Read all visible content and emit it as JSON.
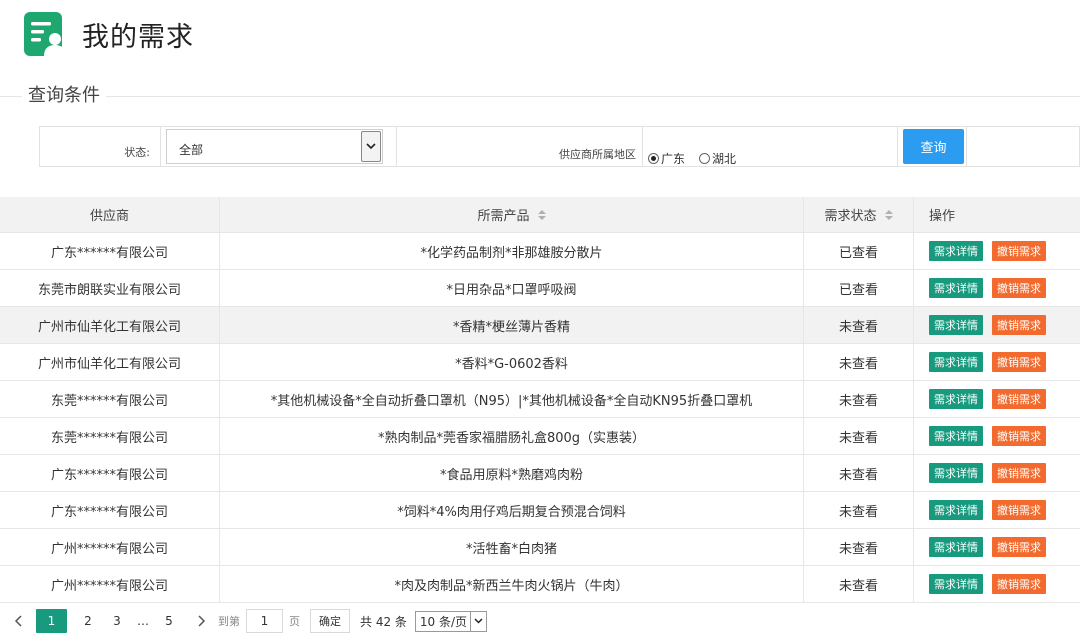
{
  "page": {
    "title": "我的需求"
  },
  "filter": {
    "section_title": "查询条件",
    "status_label": "状态:",
    "status_value": "全部",
    "region_label": "供应商所属地区",
    "region_options": [
      {
        "label": "广东",
        "checked": true
      },
      {
        "label": "湖北",
        "checked": false
      }
    ],
    "query_button": "查询"
  },
  "table": {
    "headers": [
      "供应商",
      "所需产品",
      "需求状态",
      "操作"
    ],
    "action_labels": {
      "detail": "需求详情",
      "cancel": "撤销需求"
    },
    "rows": [
      {
        "supplier": "广东******有限公司",
        "product": "*化学药品制剂*非那雄胺分散片",
        "status": "已查看"
      },
      {
        "supplier": "东莞市朗联实业有限公司",
        "product": "*日用杂品*口罩呼吸阀",
        "status": "已查看"
      },
      {
        "supplier": "广州市仙羊化工有限公司",
        "product": "*香精*梗丝薄片香精",
        "status": "未查看"
      },
      {
        "supplier": "广州市仙羊化工有限公司",
        "product": "*香料*G-0602香料",
        "status": "未查看"
      },
      {
        "supplier": "东莞******有限公司",
        "product": "*其他机械设备*全自动折叠口罩机（N95）|*其他机械设备*全自动KN95折叠口罩机",
        "status": "未查看"
      },
      {
        "supplier": "东莞******有限公司",
        "product": "*熟肉制品*莞香家福腊肠礼盒800g（实惠装）",
        "status": "未查看"
      },
      {
        "supplier": "广东******有限公司",
        "product": "*食品用原料*熟磨鸡肉粉",
        "status": "未查看"
      },
      {
        "supplier": "广东******有限公司",
        "product": "*饲料*4%肉用仔鸡后期复合预混合饲料",
        "status": "未查看"
      },
      {
        "supplier": "广州******有限公司",
        "product": "*活牲畜*白肉猪",
        "status": "未查看"
      },
      {
        "supplier": "广州******有限公司",
        "product": "*肉及肉制品*新西兰牛肉火锅片（牛肉）",
        "status": "未查看"
      }
    ]
  },
  "pagination": {
    "pages": [
      "1",
      "2",
      "3",
      "…",
      "5"
    ],
    "current": "1",
    "goto_label": "到第",
    "goto_value": "1",
    "page_label": "页",
    "confirm_label": "确定",
    "total_label": "共 42 条",
    "page_size": "10 条/页"
  },
  "colors": {
    "accent": "#189a7f",
    "danger": "#f26a2e",
    "primary": "#2c9cf0"
  },
  "icons": {
    "logo": "document-user-icon",
    "select": "chevron-down-icon",
    "prev": "chevron-left-icon",
    "next": "chevron-right-icon"
  }
}
